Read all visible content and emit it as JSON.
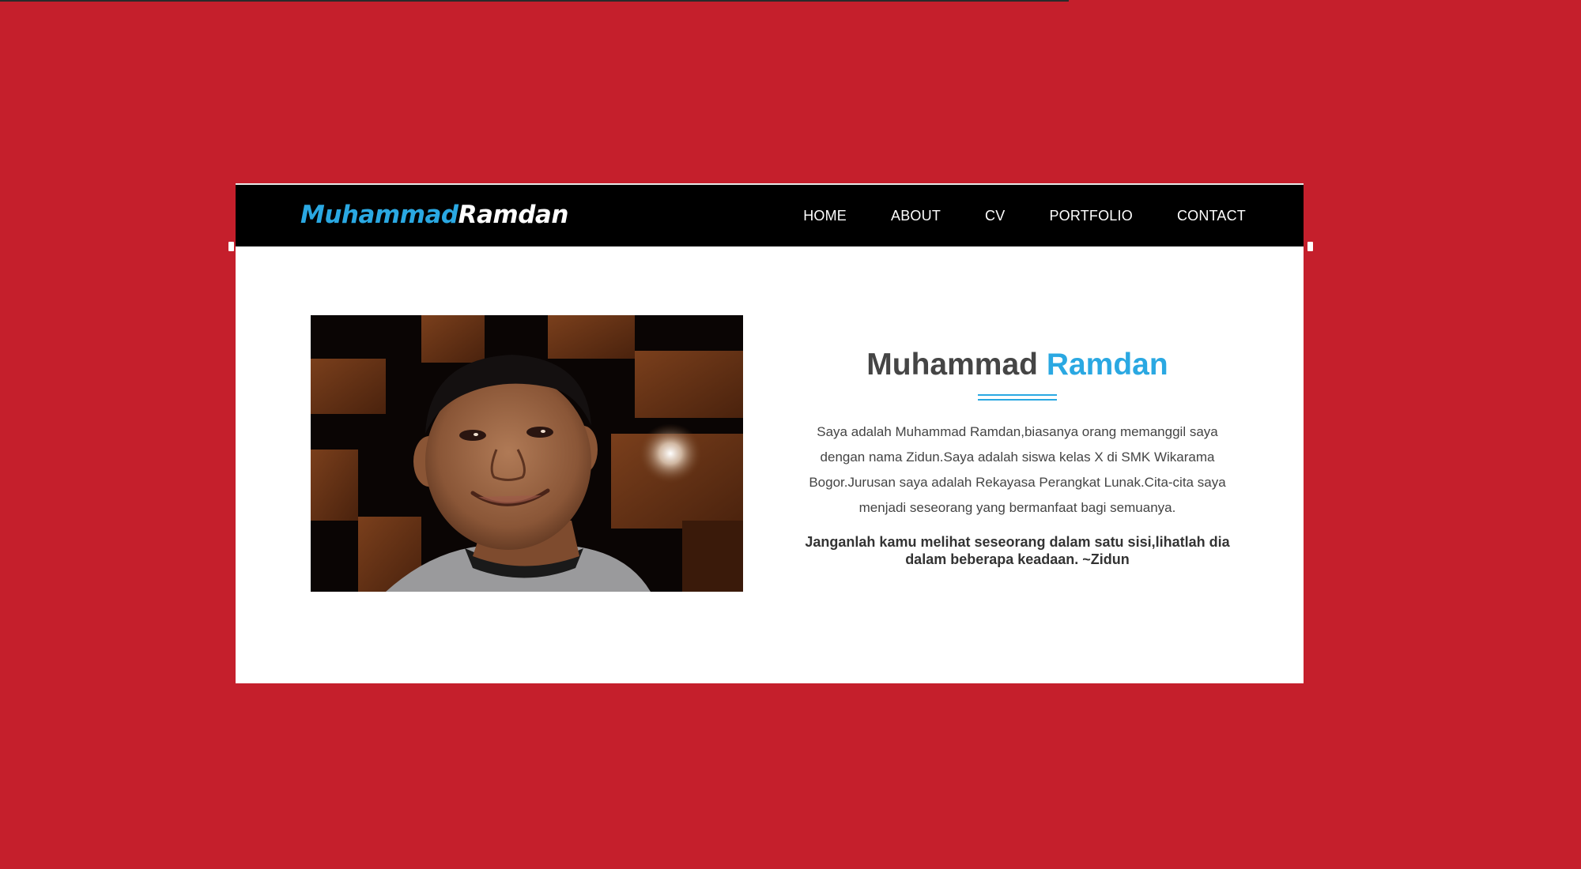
{
  "brand": {
    "first": "Muhammad",
    "last": "Ramdan"
  },
  "nav": {
    "items": [
      {
        "label": "HOME"
      },
      {
        "label": "ABOUT"
      },
      {
        "label": "CV"
      },
      {
        "label": "PORTFOLIO"
      },
      {
        "label": "CONTACT"
      }
    ]
  },
  "about": {
    "title_first": "Muhammad",
    "title_last": "Ramdan",
    "description": "Saya adalah Muhammad Ramdan,biasanya orang memanggil saya dengan nama Zidun.Saya adalah siswa kelas X di SMK Wikarama Bogor.Jurusan saya adalah Rekayasa Perangkat Lunak.Cita-cita saya menjadi seseorang yang bermanfaat bagi semuanya.",
    "quote": "Janganlah kamu melihat seseorang dalam satu sisi,lihatlah dia dalam beberapa keadaan. ~Zidun"
  },
  "colors": {
    "background": "#c51f2c",
    "accent": "#2aa8e2",
    "navbar": "#000000",
    "card": "#ffffff"
  }
}
